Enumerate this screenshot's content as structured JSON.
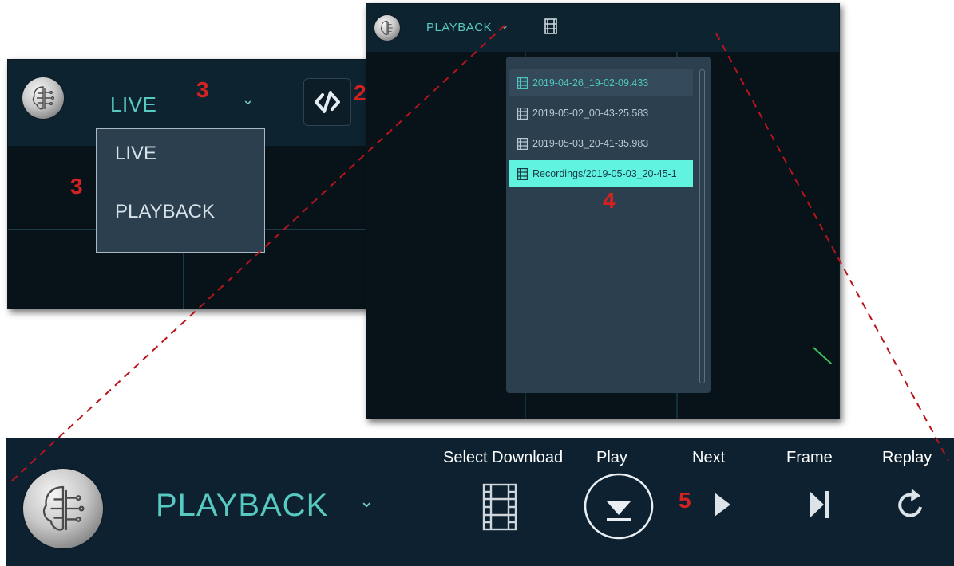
{
  "live_panel": {
    "mode_label": "LIVE",
    "dropdown_options": [
      "LIVE",
      "PLAYBACK"
    ]
  },
  "playback_panel": {
    "mode_label": "PLAYBACK",
    "recordings": [
      "2019-04-26_19-02-09.433",
      "2019-05-02_00-43-25.583",
      "2019-05-03_20-41-35.983",
      "Recordings/2019-05-03_20-45-1"
    ]
  },
  "toolbar": {
    "mode_label": "PLAYBACK",
    "select_download_label": "Select Download",
    "play_label": "Play",
    "next_label": "Next",
    "frame_label": "Frame",
    "replay_label": "Replay"
  },
  "annotations": {
    "code_toggle": "2",
    "mode_selector": "3",
    "dropdown": "3",
    "recording_list": "4",
    "controls": "5"
  },
  "icons": [
    "brain-logo-icon",
    "chevron-down-icon",
    "code-toggle-icon",
    "film-icon",
    "play-download-icon",
    "next-icon",
    "frame-step-icon",
    "replay-icon"
  ],
  "colors": {
    "header_bg": "#0e2330",
    "accent_teal": "#57c9c1",
    "selected_row": "#5ff3e0",
    "annotation_red": "#d42222",
    "dropdown_bg": "#2b3f4e"
  }
}
